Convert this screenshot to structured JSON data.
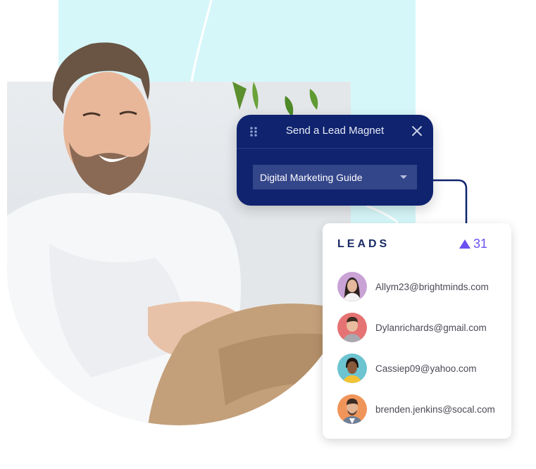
{
  "magnet_panel": {
    "title": "Send a Lead Magnet",
    "icons": {
      "drag": "drag-handle-icon",
      "close": "close-icon"
    },
    "dropdown": {
      "selected": "Digital Marketing Guide",
      "icon": "caret-down-icon"
    }
  },
  "leads_panel": {
    "title": "LEADS",
    "count": "31",
    "trend_icon": "triangle-up-icon",
    "items": [
      {
        "email": "Allym23@brightminds.com",
        "avatar_bg": "#c9a3d6"
      },
      {
        "email": "Dylanrichards@gmail.com",
        "avatar_bg": "#e57373"
      },
      {
        "email": "Cassiep09@yahoo.com",
        "avatar_bg": "#6cc4d0"
      },
      {
        "email": "brenden.jenkins@socal.com",
        "avatar_bg": "#f0955a"
      }
    ]
  },
  "colors": {
    "panel_bg": "#0f236e",
    "accent": "#6b4ff0",
    "background_shape": "#d6f7fa"
  }
}
